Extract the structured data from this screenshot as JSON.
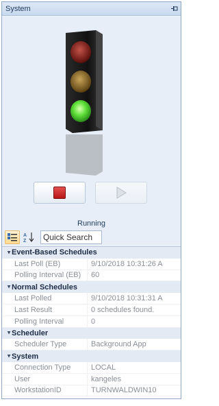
{
  "panel": {
    "title": "System"
  },
  "status": {
    "state_label": "Running",
    "light_colors": {
      "red": "#8a1a14",
      "amber": "#8a6a14",
      "green": "#5fe03a"
    }
  },
  "controls": {
    "stop_icon": "stop-square-icon",
    "play_icon": "play-triangle-icon"
  },
  "toolbar": {
    "categorized_icon": "categorized-icon",
    "alphabetical_icon": "sort-az-icon",
    "search_placeholder": "Quick Search"
  },
  "properties": {
    "categories": [
      {
        "name": "Event-Based Schedules",
        "rows": [
          {
            "name": "Last Poll (EB)",
            "value": "9/10/2018 10:31:26 A"
          },
          {
            "name": "Polling Interval (EB)",
            "value": "60"
          }
        ]
      },
      {
        "name": "Normal Schedules",
        "rows": [
          {
            "name": "Last Polled",
            "value": "9/10/2018 10:31:31 A"
          },
          {
            "name": "Last Result",
            "value": " 0 schedules found."
          },
          {
            "name": "Polling Interval",
            "value": "0"
          }
        ]
      },
      {
        "name": "Scheduler",
        "rows": [
          {
            "name": "Scheduler Type",
            "value": "Background App"
          }
        ]
      },
      {
        "name": "System",
        "rows": [
          {
            "name": "Connection Type",
            "value": "LOCAL"
          },
          {
            "name": "User",
            "value": "kangeles"
          },
          {
            "name": "WorkstationID",
            "value": "TURNWALDWIN10"
          }
        ]
      }
    ]
  }
}
